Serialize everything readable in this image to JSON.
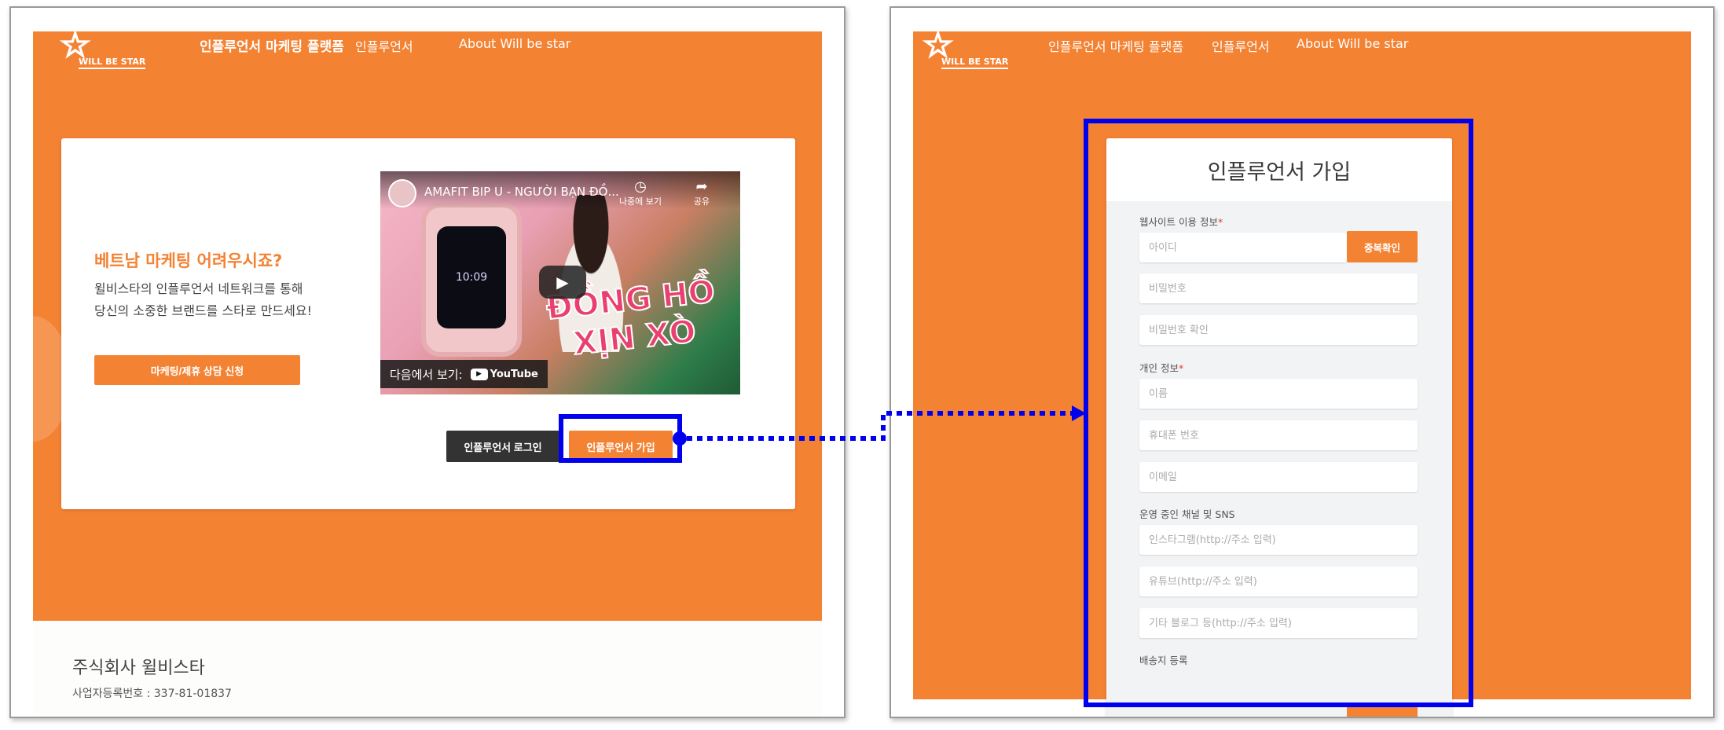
{
  "left_screen": {
    "nav": {
      "logo_text": "WILL BE STAR",
      "brand": "인플루언서 마케팅 플랫폼",
      "link_influencer": "인플루언서",
      "link_about": "About Will be star"
    },
    "hero": {
      "title": "베트남 마케팅 어려우시죠?",
      "description": "윌비스타의 인플루언서 네트워크를 통해 당신의 소중한 브랜드를 스타로 만드세요!",
      "consult_button": "마케팅/제휴 상담 신청"
    },
    "video": {
      "title": "AMAFIT BIP U - NGƯỜI BẠN ĐỒ...",
      "watch_later": "나중에 보기",
      "share": "공유",
      "watch_on": "다음에서 보기:",
      "platform": "YouTube",
      "watch_face": "10:09",
      "slogan": "ĐỒNG HỒ XỊN XÒ"
    },
    "login_button": "인플루언서 로그인",
    "signup_button": "인플루언서 가입",
    "footer": {
      "company": "주식회사 윌비스타",
      "registration": "사업자등록번호 : 337-81-01837"
    }
  },
  "right_screen": {
    "nav": {
      "logo_text": "WILL BE STAR",
      "brand": "인플루언서 마케팅 플랫폼",
      "link_influencer": "인플루언서",
      "link_about": "About Will be star"
    },
    "form": {
      "title": "인플루언서 가입",
      "section_site": "웹사이트 이용 정보",
      "id_placeholder": "아이디",
      "dup_check_button": "중복확인",
      "password_placeholder": "비밀번호",
      "password_confirm_placeholder": "비밀번호 확인",
      "section_personal": "개인 정보",
      "name_placeholder": "이름",
      "phone_placeholder": "휴대폰 번호",
      "email_placeholder": "이메일",
      "section_channels": "운영 중인 채널 및 SNS",
      "instagram_placeholder": "인스타그램(http://주소 입력)",
      "youtube_placeholder": "유튜브(http://주소 입력)",
      "blog_placeholder": "기타 블로그 등(http://주소 입력)",
      "section_shipping": "배송지 등록",
      "required_mark": "*"
    }
  },
  "colors": {
    "brand_orange": "#f48233",
    "annotation_blue": "#0000ee",
    "dark_button": "#333333"
  }
}
